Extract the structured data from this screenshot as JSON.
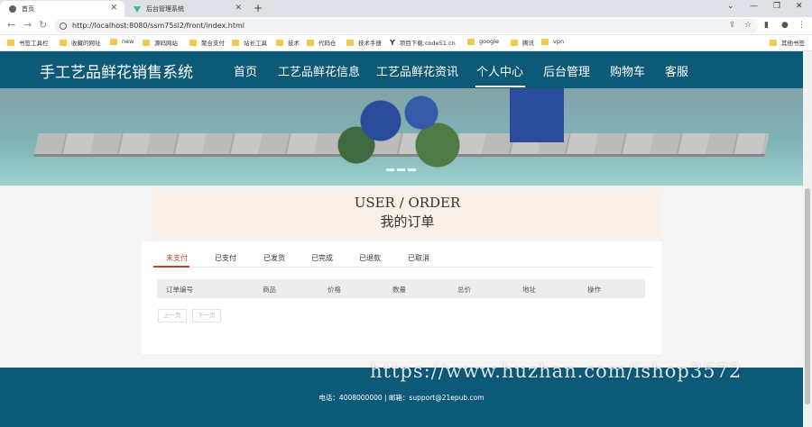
{
  "browser": {
    "tabs": [
      {
        "title": "首页"
      },
      {
        "title": "后台管理系统"
      }
    ],
    "url": "http://localhost:8080/ssm75sl2/front/index.html",
    "bookmarks": [
      "书签工具栏",
      "收藏的网址",
      "new",
      "源码网站",
      "聚合支付",
      "站长工具",
      "技术",
      "代码仓",
      "技术手册",
      "项目下载:code51.cn",
      "google",
      "腾讯",
      "vpn",
      "其他书签"
    ]
  },
  "site": {
    "logo": "手工艺品鲜花销售系统",
    "nav": [
      "首页",
      "工艺品鲜花信息",
      "工艺品鲜花资讯",
      "个人中心",
      "后台管理",
      "购物车",
      "客服"
    ],
    "active_nav": "个人中心"
  },
  "order": {
    "title_en": "USER / ORDER",
    "title_cn": "我的订单",
    "tabs": [
      "未支付",
      "已支付",
      "已发货",
      "已完成",
      "已退款",
      "已取消"
    ],
    "active_tab": "未支付",
    "columns": [
      "订单编号",
      "商品",
      "价格",
      "数量",
      "总价",
      "地址",
      "操作"
    ],
    "prev": "上一页",
    "next": "下一页"
  },
  "footer": {
    "contact": "电话：4008000000 | 邮箱：support@21epub.com"
  },
  "watermark": "https://www.huzhan.com/ishop3572",
  "colors": {
    "primary": "#0c5a77",
    "accent": "#b5472a"
  }
}
